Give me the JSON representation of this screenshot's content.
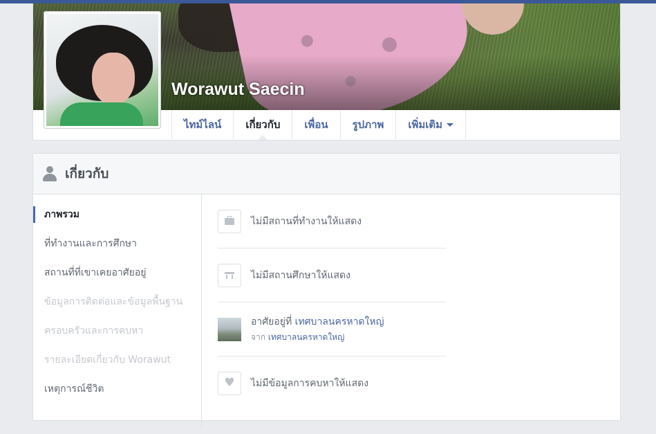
{
  "profile": {
    "name": "Worawut Saecin"
  },
  "tabs": [
    {
      "label": "ไทม์ไลน์"
    },
    {
      "label": "เกี่ยวกับ"
    },
    {
      "label": "เพื่อน"
    },
    {
      "label": "รูปภาพ"
    },
    {
      "label": "เพิ่มเติม"
    }
  ],
  "about": {
    "title": "เกี่ยวกับ",
    "sidebar": [
      {
        "label": "ภาพรวม"
      },
      {
        "label": "ที่ทำงานและการศึกษา"
      },
      {
        "label": "สถานที่ที่เขาเคยอาศัยอยู่"
      },
      {
        "label": "ข้อมูลการติดต่อและข้อมูลพื้นฐาน"
      },
      {
        "label": "ครอบครัวและการคบหา"
      },
      {
        "label": "รายละเอียดเกี่ยวกับ Worawut"
      },
      {
        "label": "เหตุการณ์ชีวิต"
      }
    ],
    "rows": {
      "work": "ไม่มีสถานที่ทำงานให้แสดง",
      "education": "ไม่มีสถานศึกษาให้แสดง",
      "lives_prefix": "อาศัยอยู่ที่ ",
      "lives_link": "เทศบาลนครหาดใหญ่",
      "from_prefix": "จาก ",
      "from_link": "เทศบาลนครหาดใหญ่",
      "relationship": "ไม่มีข้อมูลการคบหาให้แสดง"
    }
  },
  "colors": {
    "brand": "#3b5998",
    "link": "#4b67a1",
    "page_bg": "#e9ebee"
  }
}
